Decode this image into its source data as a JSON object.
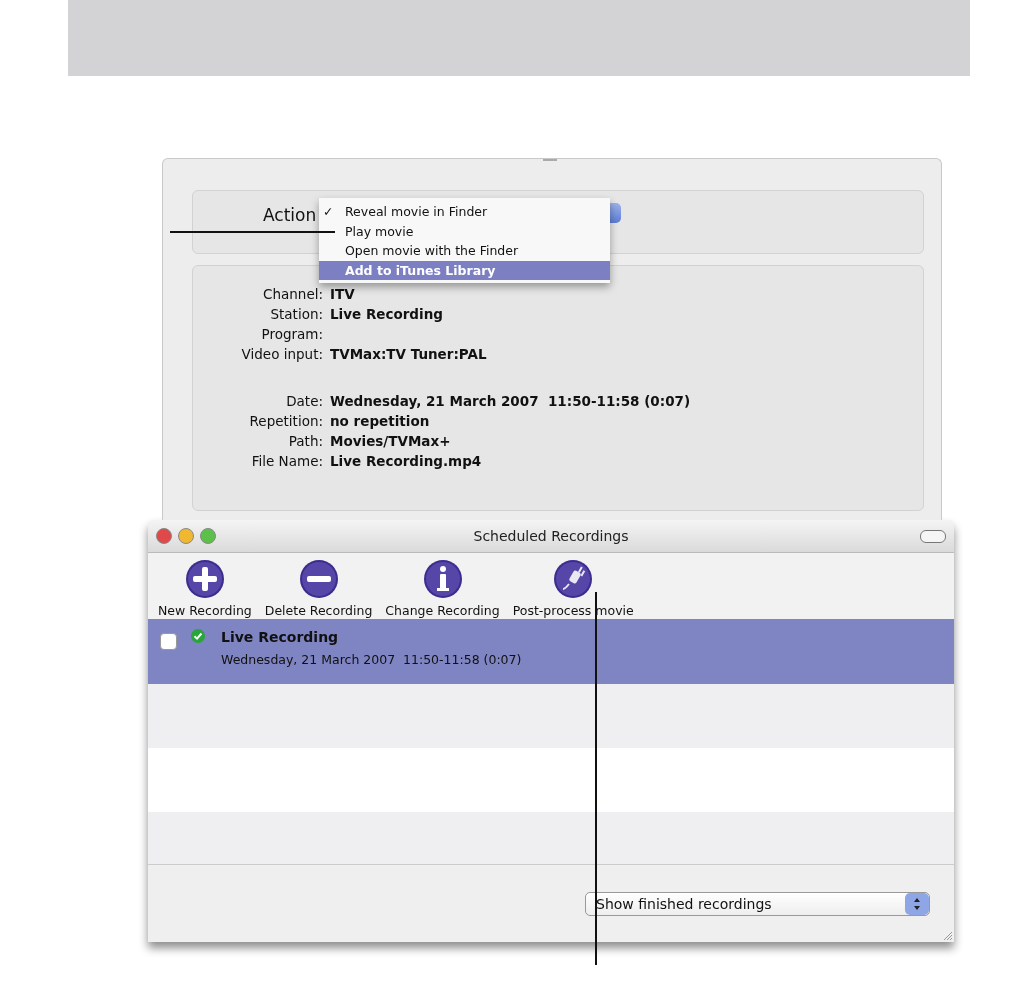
{
  "back_window": {
    "action": {
      "label": "Action",
      "menu": [
        {
          "label": "Reveal movie in Finder",
          "checked": true,
          "selected": false
        },
        {
          "label": "Play movie",
          "checked": false,
          "selected": false
        },
        {
          "label": "Open movie with the Finder",
          "checked": false,
          "selected": false
        },
        {
          "label": "Add to iTunes Library",
          "checked": false,
          "selected": true
        }
      ],
      "check_mark": "✓"
    },
    "field_groups": [
      [
        {
          "label": "Channel:",
          "value": "ITV"
        },
        {
          "label": "Station:",
          "value": "Live Recording"
        },
        {
          "label": "Program:"
        },
        {
          "label": "Video input:",
          "value": "TVMax:TV Tuner:PAL"
        }
      ],
      [
        {
          "label": "Date:",
          "value": "Wednesday, 21 March 2007  11:50-11:58 (0:07)"
        },
        {
          "label": "Repetition:",
          "value": "no repetition"
        },
        {
          "label": "Path:",
          "value": "Movies/TVMax+"
        },
        {
          "label": "File Name:",
          "value": "Live Recording.mp4"
        }
      ]
    ]
  },
  "window": {
    "title": "Scheduled Recordings",
    "toolbar": [
      {
        "label": "New Recording",
        "kind": "plus"
      },
      {
        "label": "Delete Recording",
        "kind": "minus"
      },
      {
        "label": "Change Recording",
        "kind": "info"
      },
      {
        "label": "Post-process movie",
        "kind": "plug"
      }
    ],
    "recordings": [
      {
        "title": "Live Recording",
        "time": "Wednesday, 21 March 2007  11:50-11:58 (0:07)",
        "selected": true,
        "checked": false,
        "done": true
      }
    ],
    "filter": {
      "value": "Show finished recordings"
    }
  }
}
